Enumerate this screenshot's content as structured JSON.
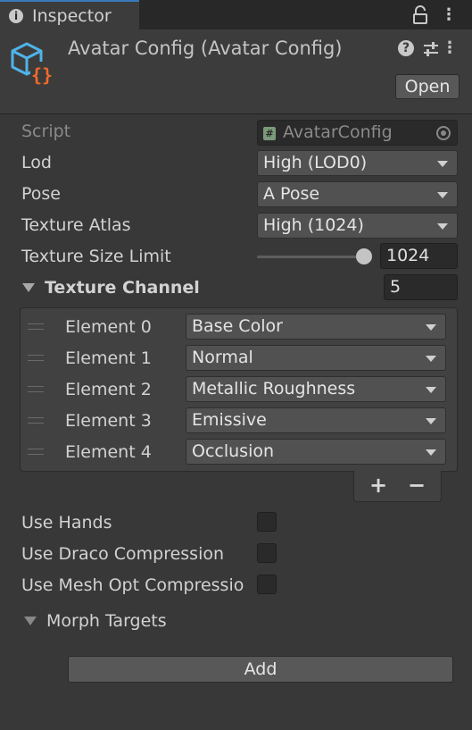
{
  "tab": {
    "icon": "info-icon",
    "label": "Inspector"
  },
  "tab_actions": {
    "lock_icon": "lock-icon",
    "menu_icon": "kebab-menu-icon",
    "menu_glyph": "⋮"
  },
  "header": {
    "title": "Avatar Config (Avatar Config)",
    "asset_icon": "scriptable-object-icon",
    "help_icon": "help-icon",
    "help_glyph": "?",
    "presets_icon": "presets-icon",
    "menu_icon": "kebab-menu-icon",
    "menu_glyph": "⋮",
    "open_label": "Open"
  },
  "properties": {
    "script": {
      "label": "Script",
      "value": "AvatarConfig",
      "file_glyph": "#"
    },
    "lod": {
      "label": "Lod",
      "value": "High (LOD0)"
    },
    "pose": {
      "label": "Pose",
      "value": "A Pose"
    },
    "texture_atlas": {
      "label": "Texture Atlas",
      "value": "High (1024)"
    },
    "texture_size_limit": {
      "label": "Texture Size Limit",
      "value": "1024",
      "slider_fraction": 1.0
    },
    "texture_channel": {
      "label": "Texture Channel",
      "size": "5",
      "elements": [
        {
          "label": "Element 0",
          "value": "Base Color"
        },
        {
          "label": "Element 1",
          "value": "Normal"
        },
        {
          "label": "Element 2",
          "value": "Metallic Roughness"
        },
        {
          "label": "Element 3",
          "value": "Emissive"
        },
        {
          "label": "Element 4",
          "value": "Occlusion"
        }
      ],
      "add_glyph": "+",
      "remove_glyph": "−"
    },
    "use_hands": {
      "label": "Use Hands",
      "checked": false
    },
    "use_draco": {
      "label": "Use Draco Compression",
      "checked": false
    },
    "use_meshopt": {
      "label": "Use Mesh Opt Compressio",
      "checked": false
    },
    "morph_targets": {
      "label": "Morph Targets",
      "add_label": "Add"
    }
  },
  "colors": {
    "background": "#383838",
    "tab_accent": "#3a79bb",
    "asset_icon_blue": "#4fb3e8",
    "asset_icon_orange": "#f06a2a"
  }
}
